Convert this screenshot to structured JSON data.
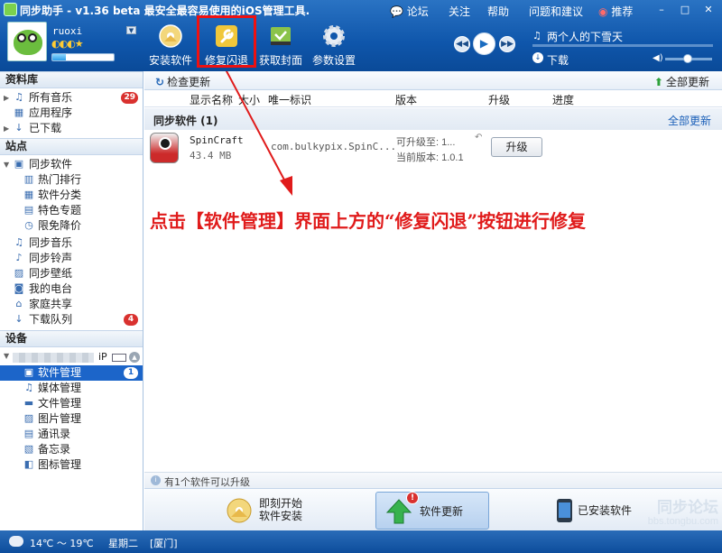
{
  "app": {
    "title": "同步助手 - v1.36 beta  最安全最容易使用的iOS管理工具."
  },
  "topbar": {
    "forum": "论坛",
    "follow": "关注",
    "help": "帮助",
    "feedback": "问题和建议",
    "recommend": "推荐"
  },
  "window": {
    "min": "–",
    "max": "□",
    "close": "✕"
  },
  "user": {
    "name": "ruoxi",
    "level_icons": "◐◐◐★",
    "level_progress": 0.22
  },
  "toolbar": {
    "install": "安装软件",
    "repair": "修复闪退",
    "cover": "获取封面",
    "settings": "参数设置"
  },
  "player": {
    "prev": "◀◀",
    "play": "▶",
    "next": "▶▶",
    "song_icon": "♫",
    "song": "两个人的下雪天",
    "download": "下载"
  },
  "sidebar": {
    "library_title": "资料库",
    "library": [
      {
        "label": "所有音乐",
        "badge": "29"
      },
      {
        "label": "应用程序",
        "badge": ""
      },
      {
        "label": "已下载",
        "badge": ""
      }
    ],
    "station_title": "站点",
    "station_sync": "同步软件",
    "station_sub": [
      {
        "label": "热门排行"
      },
      {
        "label": "软件分类"
      },
      {
        "label": "特色专题"
      },
      {
        "label": "限免降价"
      }
    ],
    "station": [
      {
        "label": "同步音乐",
        "badge": ""
      },
      {
        "label": "同步铃声",
        "badge": ""
      },
      {
        "label": "同步壁纸",
        "badge": ""
      },
      {
        "label": "我的电台",
        "badge": ""
      },
      {
        "label": "家庭共享",
        "badge": ""
      },
      {
        "label": "下载队列",
        "badge": "4"
      }
    ],
    "device_title": "设备",
    "device_suffix": "iP",
    "device": [
      {
        "label": "软件管理",
        "badge": "1"
      },
      {
        "label": "媒体管理",
        "badge": ""
      },
      {
        "label": "文件管理",
        "badge": ""
      },
      {
        "label": "图片管理",
        "badge": ""
      },
      {
        "label": "通讯录",
        "badge": ""
      },
      {
        "label": "备忘录",
        "badge": ""
      },
      {
        "label": "图标管理",
        "badge": ""
      }
    ]
  },
  "main": {
    "check_update": "检查更新",
    "update_all": "全部更新",
    "columns": {
      "name": "显示名称",
      "size": "大小",
      "id": "唯一标识",
      "version": "版本",
      "upgrade": "升级",
      "progress": "进度"
    },
    "group_title": "同步软件 (1)",
    "group_update_all": "全部更新",
    "app": {
      "name": "SpinCraft",
      "size": "43.4 MB",
      "bundle": "com.bulkypix.SpinC...",
      "upgrade_to": "可升级至: 1...",
      "current": "当前版本: 1.0.1",
      "upgrade_btn": "升级"
    },
    "annotation": "点击【软件管理】界面上方的“修复闪退”按钮进行修复",
    "status": "有1个软件可以升级"
  },
  "bottom_tabs": {
    "install_now_line1": "即刻开始",
    "install_now_line2": "软件安装",
    "updates": "软件更新",
    "updates_badge": "!",
    "installed": "已安装软件"
  },
  "watermark": {
    "text": "同步论坛",
    "url": "bbs.tongbu.com"
  },
  "footer": {
    "temp": "14℃ ～ 19℃",
    "day": "星期二",
    "city": "[厦门]"
  },
  "colors": {
    "header": "#0f56ab",
    "selection": "#1c65c9",
    "badge": "#d9312f",
    "annotation": "#e01b1b"
  }
}
